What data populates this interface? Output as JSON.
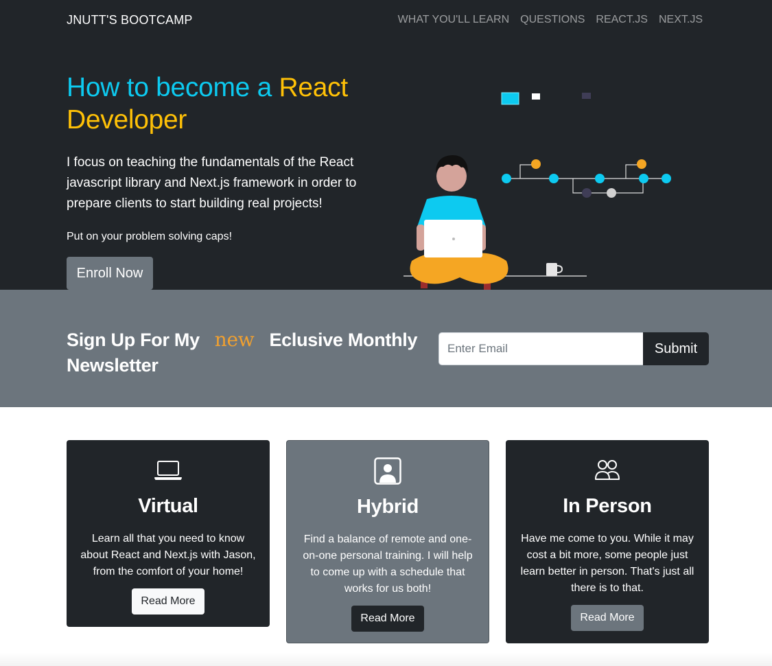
{
  "navbar": {
    "brand": "JNUTT'S BOOTCAMP",
    "links": [
      "WHAT YOU'LL LEARN",
      "QUESTIONS",
      "REACT.JS",
      "NEXT.JS"
    ]
  },
  "hero": {
    "title_part1": "How to become a ",
    "title_part2": "React Developer",
    "lead": "I focus on teaching the fundamentals of the React javascript library and Next.js framework in order to prepare clients to start building real projects!",
    "sub": "Put on your problem solving caps!",
    "enroll_label": "Enroll Now"
  },
  "newsletter": {
    "title_part1": "Sign Up For My",
    "new_word": "new",
    "title_part2": "Eclusive Monthly Newsletter",
    "email_placeholder": "Enter Email",
    "submit_label": "Submit"
  },
  "cards": [
    {
      "title": "Virtual",
      "text": "Learn all that you need to know about React and Next.js with Jason, from the comfort of your home!",
      "button": "Read More",
      "icon": "laptop-icon"
    },
    {
      "title": "Hybrid",
      "text": "Find a balance of remote and one-on-one personal training. I will help to come up with a schedule that works for us both!",
      "button": "Read More",
      "icon": "person-badge-icon"
    },
    {
      "title": "In Person",
      "text": "Have me come to you. While it may cost a bit more, some people just learn better in person. That's just all there is to that.",
      "button": "Read More",
      "icon": "people-icon"
    }
  ],
  "colors": {
    "dark": "#212529",
    "secondary": "#6c757d",
    "warning": "#ffc107",
    "info": "#0dcaf0",
    "accent_orange": "#f0a030"
  }
}
